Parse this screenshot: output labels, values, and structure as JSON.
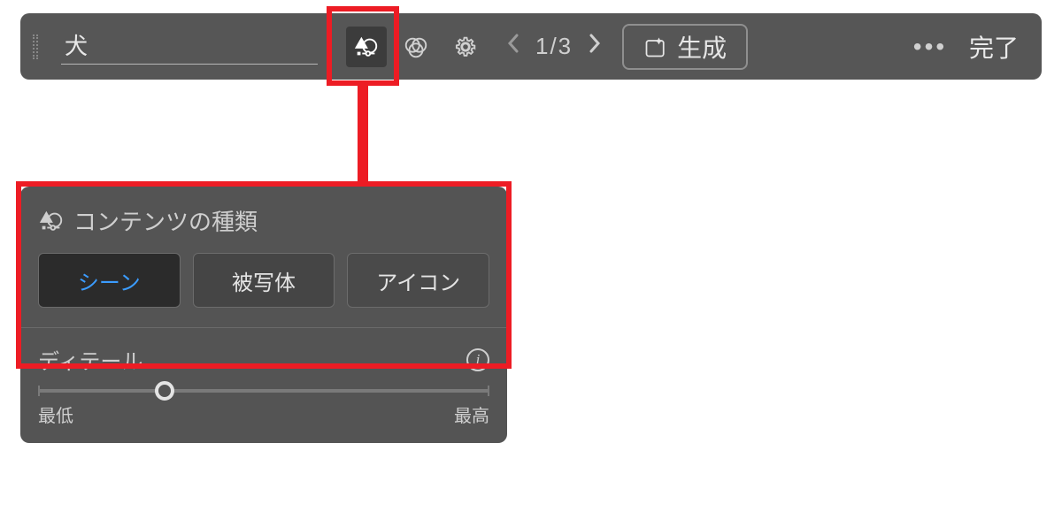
{
  "toolbar": {
    "search_value": "犬",
    "pager": {
      "current": 1,
      "total": 3,
      "display": "1/3"
    },
    "generate_label": "生成",
    "done_label": "完了"
  },
  "panel": {
    "content_type": {
      "title": "コンテンツの種類",
      "options": [
        {
          "label": "シーン",
          "selected": true
        },
        {
          "label": "被写体",
          "selected": false
        },
        {
          "label": "アイコン",
          "selected": false
        }
      ]
    },
    "detail": {
      "title": "ディテール",
      "min_label": "最低",
      "max_label": "最高",
      "value_percent": 28
    }
  },
  "annotation": {
    "highlight_color": "#ed1c24"
  }
}
